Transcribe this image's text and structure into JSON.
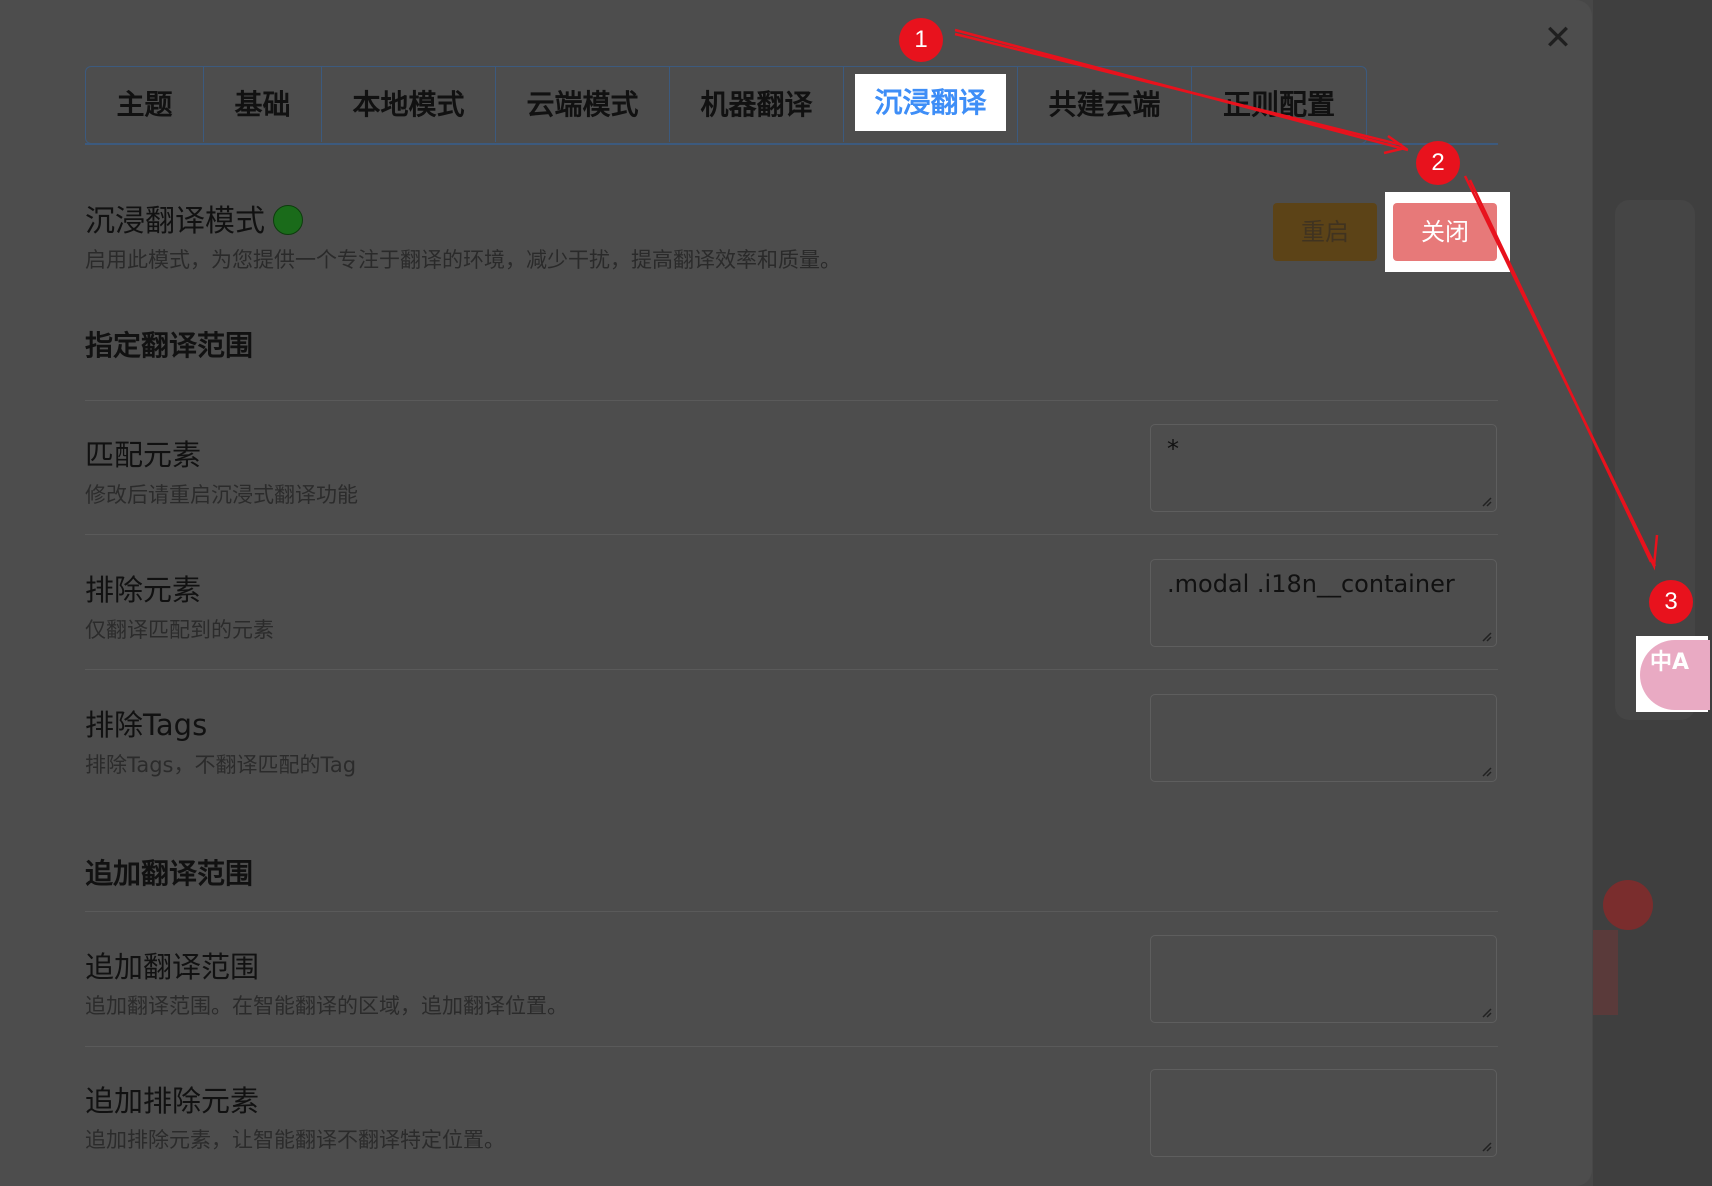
{
  "tabs": [
    {
      "label": "主题",
      "active": false
    },
    {
      "label": "基础",
      "active": false
    },
    {
      "label": "本地模式",
      "active": false
    },
    {
      "label": "云端模式",
      "active": false
    },
    {
      "label": "机器翻译",
      "active": false
    },
    {
      "label": "沉浸翻译",
      "active": true
    },
    {
      "label": "共建云端",
      "active": false
    },
    {
      "label": "正则配置",
      "active": false
    }
  ],
  "mode": {
    "title": "沉浸翻译模式",
    "description": "启用此模式，为您提供一个专注于翻译的环境，减少干扰，提高翻译效率和质量。",
    "restart_label": "重启",
    "close_label": "关闭",
    "status_color": "#1a6b1a"
  },
  "scope_section": {
    "title": "指定翻译范围",
    "rows": [
      {
        "label": "匹配元素",
        "hint": "修改后请重启沉浸式翻译功能",
        "value": "*"
      },
      {
        "label": "排除元素",
        "hint": "仅翻译匹配到的元素",
        "value": ".modal .i18n__container"
      },
      {
        "label": "排除Tags",
        "hint": "排除Tags，不翻译匹配的Tag",
        "value": ""
      }
    ]
  },
  "append_section": {
    "title": "追加翻译范围",
    "rows": [
      {
        "label": "追加翻译范围",
        "hint": "追加翻译范围。在智能翻译的区域，追加翻译位置。",
        "value": ""
      },
      {
        "label": "追加排除元素",
        "hint": "追加排除元素，让智能翻译不翻译特定位置。",
        "value": ""
      }
    ]
  },
  "annotations": {
    "badge1": "1",
    "badge2": "2",
    "badge3": "3",
    "color": "#e8121d"
  },
  "floating_button": {
    "icon": "translate-icon",
    "glyph": "中A"
  },
  "accent_colors": {
    "active_tab_text": "#3e8ef7",
    "close_button": "#e77979",
    "restart_button": "#5c4317"
  }
}
